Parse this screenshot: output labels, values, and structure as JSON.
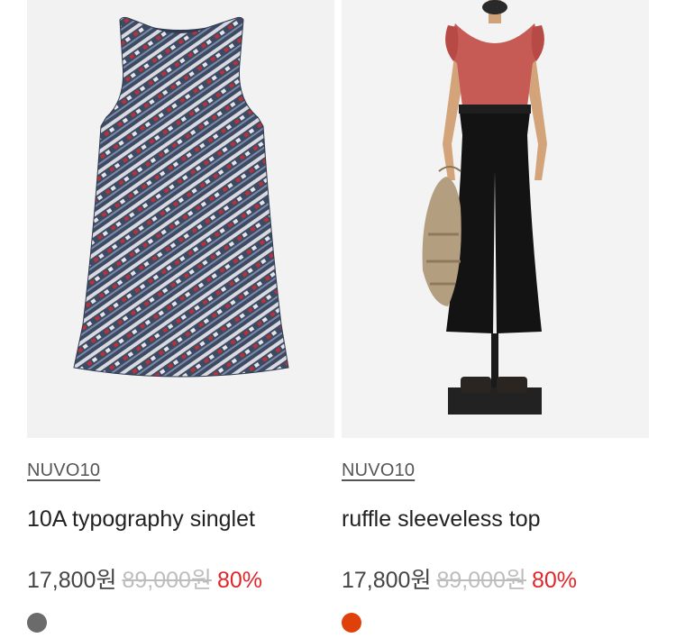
{
  "products": [
    {
      "image_alt": "patterned sleeveless dress",
      "brand": "NUVO10",
      "name": "10A typography singlet",
      "price": "17,800원",
      "original_price": "89,000원",
      "discount": "80%",
      "color_swatch": "#6b6b6b"
    },
    {
      "image_alt": "ruffle sleeveless top on mannequin",
      "brand": "NUVO10",
      "name": "ruffle sleeveless top",
      "price": "17,800원",
      "original_price": "89,000원",
      "discount": "80%",
      "color_swatch": "#e0400a"
    }
  ],
  "colors": {
    "discount": "#e0262a",
    "original_price": "#bdbdbd",
    "brand": "#555555"
  }
}
